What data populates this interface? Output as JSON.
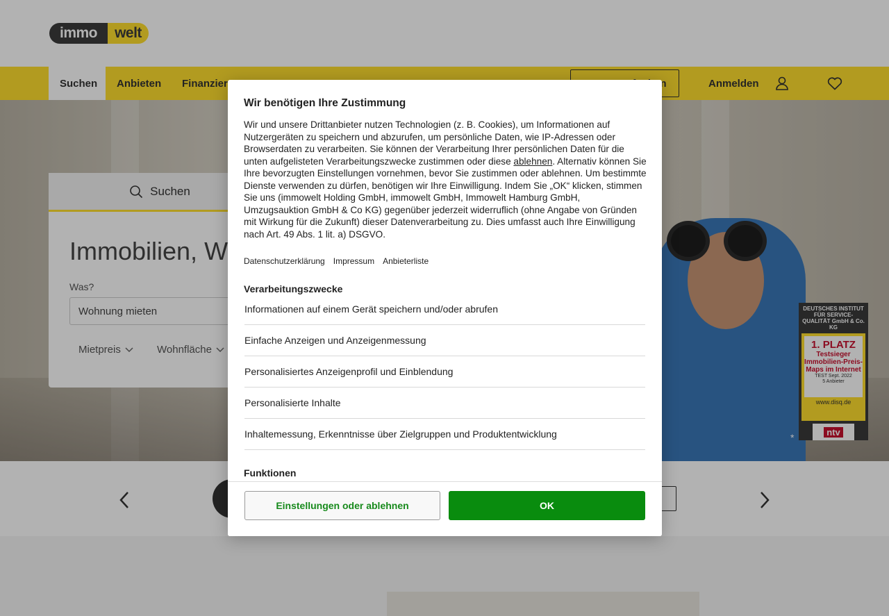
{
  "header": {
    "logo_left": "immo",
    "logo_right": "welt"
  },
  "nav": {
    "items": [
      {
        "label": "Suchen",
        "active": true
      },
      {
        "label": "Anbieten",
        "active": false
      },
      {
        "label": "Finanzieren",
        "active": false
      }
    ],
    "cta_label": "Inserat aufgeben",
    "login_label": "Anmelden",
    "icons": [
      "user-icon",
      "heart-icon"
    ]
  },
  "hero": {
    "search_tab_label": "Suchen",
    "title": "Immobilien, Wohnungen und Häuser",
    "was_label": "Was?",
    "search_value": "Wohnung mieten",
    "filters": [
      "Mietpreis",
      "Wohnfläche"
    ],
    "badge": {
      "top": "DEUTSCHES INSTITUT FÜR SERVICE-QUALITÄT GmbH & Co. KG",
      "platz": "1. PLATZ",
      "test": "Testsieger Immobilien-Preis-Maps im Internet",
      "date": "TEST Sept. 2022",
      "count": "5 Anbieter",
      "url": "www.disq.de",
      "ntv": "ntv"
    },
    "asterisk": "*"
  },
  "consent": {
    "title": "Wir benötigen Ihre Zustimmung",
    "body_part1": "Wir und unsere Drittanbieter nutzen Technologien (z. B. Cookies), um Informationen auf Nutzergeräten zu speichern und abzurufen, um persönliche Daten, wie IP-Adressen oder Browserdaten zu verarbeiten. Sie können der Verarbeitung Ihrer persönlichen Daten für die unten aufgelisteten Verarbeitungszwecke zustimmen oder diese ",
    "body_link": "ablehnen",
    "body_part2": ". Alternativ können Sie Ihre bevorzugten Einstellungen vornehmen, bevor Sie zustimmen oder ablehnen. Um bestimmte Dienste verwenden zu dürfen, benötigen wir Ihre Einwilligung. Indem Sie „OK“ klicken, stimmen Sie uns (immowelt Holding GmbH, immowelt GmbH, Immowelt Hamburg GmbH, Umzugsauktion GmbH & Co KG) gegenüber jederzeit widerruflich (ohne Angabe von Gründen mit Wirkung für die Zukunft) dieser Datenverarbeitung zu. Dies umfasst auch Ihre Einwilligung nach Art. 49 Abs. 1 lit. a) DSGVO.",
    "links": [
      "Datenschutzerklärung",
      "Impressum",
      "Anbieterliste"
    ],
    "purposes_title": "Verarbeitungszwecke",
    "purposes": [
      "Informationen auf einem Gerät speichern und/oder abrufen",
      "Einfache Anzeigen und Anzeigenmessung",
      "Personalisiertes Anzeigenprofil und Einblendung",
      "Personalisierte Inhalte",
      "Inhaltemessung, Erkenntnisse über Zielgruppen und Produktentwicklung"
    ],
    "functions_title": "Funktionen",
    "settings_button": "Einstellungen oder ablehnen",
    "ok_button": "OK"
  },
  "colors": {
    "brand_yellow": "#ffde2f",
    "ok_green": "#098c0e",
    "settings_text_green": "#178a1c"
  }
}
